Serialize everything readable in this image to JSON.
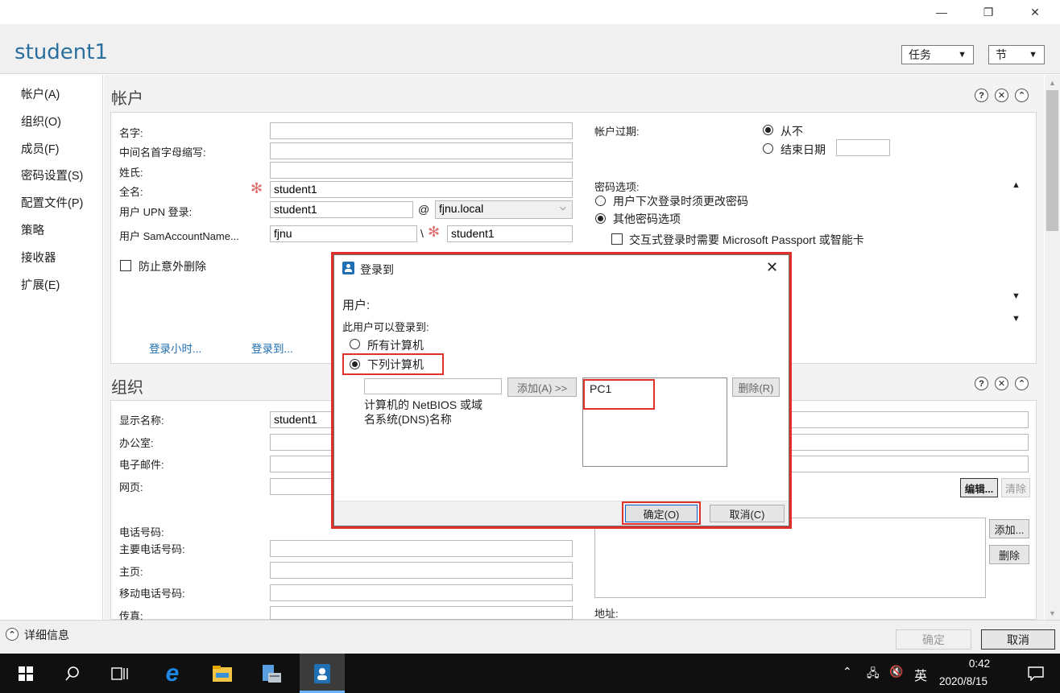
{
  "window": {
    "title": "student1",
    "tasks_label": "任务",
    "section_label": "节"
  },
  "nav": {
    "items": [
      "帐户(A)",
      "组织(O)",
      "成员(F)",
      "密码设置(S)",
      "配置文件(P)",
      "策略",
      "接收器",
      "扩展(E)"
    ]
  },
  "account": {
    "title": "帐户",
    "first_name_label": "名字:",
    "initials_label": "中间名首字母缩写:",
    "last_name_label": "姓氏:",
    "full_name_label": "全名:",
    "full_name_value": "student1",
    "upn_label": "用户 UPN 登录:",
    "upn_value": "student1",
    "at": "@",
    "domain_value": "fjnu.local",
    "sam_label": "用户 SamAccountName...",
    "sam_domain_value": "fjnu",
    "backslash": "\\",
    "sam_value": "student1",
    "protect_label": "防止意外删除",
    "logon_hours_link": "登录小时...",
    "logon_to_link": "登录到...",
    "expire_label": "帐户过期:",
    "never_label": "从不",
    "end_date_label": "结束日期",
    "pwd_options_label": "密码选项:",
    "must_change_label": "用户下次登录时须更改密码",
    "other_pwd_label": "其他密码选项",
    "passport_label": "交互式登录时需要 Microsoft Passport 或智能卡"
  },
  "org": {
    "title": "组织",
    "display_name_label": "显示名称:",
    "display_name_value": "student1",
    "office_label": "办公室:",
    "email_label": "电子邮件:",
    "web_label": "网页:",
    "phone_label": "电话号码:",
    "main_phone_label": "主要电话号码:",
    "home_label": "主页:",
    "mobile_label": "移动电话号码:",
    "fax_label": "传真:",
    "edit_button": "编辑...",
    "clear_button": "清除",
    "add_button": "添加...",
    "remove_button": "删除",
    "address_label": "地址:"
  },
  "footer": {
    "details_label": "详细信息",
    "ok_label": "确定",
    "cancel_label": "取消"
  },
  "dialog": {
    "title": "登录到",
    "user_label": "用户:",
    "can_logon_label": "此用户可以登录到:",
    "all_computers_label": "所有计算机",
    "following_computers_label": "下列计算机",
    "add_button": "添加(A) >>",
    "hint_line1": "计算机的 NetBIOS 或域",
    "hint_line2": "名系统(DNS)名称",
    "remove_button": "删除(R)",
    "computers": [
      "PC1"
    ],
    "ok_button": "确定(O)",
    "cancel_button": "取消(C)"
  },
  "taskbar": {
    "ime": "英",
    "time": "0:42",
    "date": "2020/8/15"
  },
  "colors": {
    "accent_title": "#2b6f9e",
    "link": "#1f6fb2",
    "highlight_red": "#e0302a",
    "taskbar": "#101010"
  }
}
